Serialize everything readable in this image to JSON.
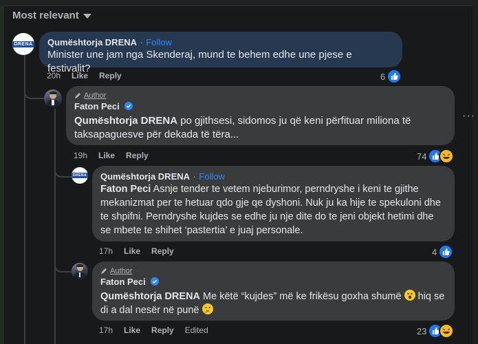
{
  "sort": {
    "label": "Most relevant"
  },
  "comments": [
    {
      "author": "Qumështorja DRENA",
      "sep": "·",
      "follow": "Follow",
      "text": "Minister une jam nga Skenderaj, mund te behem edhe une pjese e festivalit?",
      "time": "20h",
      "like": "Like",
      "reply": "Reply",
      "reactions": "6",
      "logo_text": "DRENA"
    },
    {
      "badge": "Author",
      "author": "Faton Peci",
      "mention": "Qumështorja DRENA",
      "text": " po gjithsesi, sidomos ju që keni përfituar miliona të taksapaguesve për dekada të tëra...",
      "time": "19h",
      "like": "Like",
      "reply": "Reply",
      "reactions": "74"
    },
    {
      "author": "Qumështorja DRENA",
      "sep": "·",
      "follow": "Follow",
      "mention": "Faton Peci",
      "text": " Asnje tender te vetem njeburimor, perndryshe i keni te gjithe mekanizmat per te hetuar qdo gje qe dyshoni. Nuk ju ka hije te spekuloni dhe te shpifni. Perndryshe kujdes se edhe ju nje dite do te jeni objekt hetimi dhe se mbete te shihet ‘pastertia’ e juaj personale.",
      "time": "17h",
      "like": "Like",
      "reply": "Reply",
      "reactions": "4",
      "logo_text": "DRENA"
    },
    {
      "badge": "Author",
      "author": "Faton Peci",
      "mention": "Qumështorja DRENA",
      "text_a": " Me këtë “kujdes” më ke frikësu goxha shumë ",
      "text_b": " hiq se di a dal nesër në punë ",
      "time": "17h",
      "like": "Like",
      "reply": "Reply",
      "edited": "Edited",
      "reactions": "23"
    }
  ],
  "more_options": "···",
  "colors": {
    "accent": "#2d88ff",
    "highlight_bubble": "#263951",
    "bubble": "#3a3b3c",
    "background": "#18191a"
  }
}
